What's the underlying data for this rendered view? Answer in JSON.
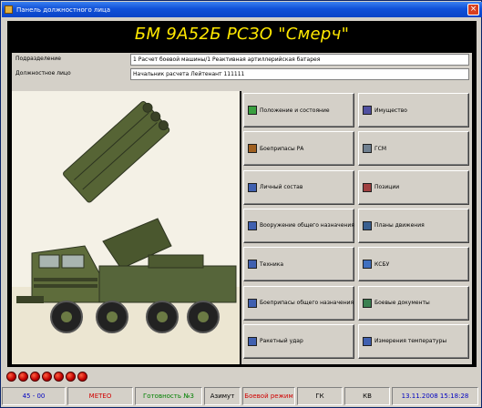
{
  "window": {
    "title": "Панель должностного лица",
    "close_glyph": "×"
  },
  "header": {
    "system_title": "БМ 9А52Б РСЗО \"Смерч\""
  },
  "info": {
    "unit_label": "Подразделение",
    "unit_value": "1 Расчет боевой машины/1 Реактивная артиллерийская батарея",
    "position_label": "Должностное лицо",
    "position_value": "Начальник расчета Лейтенант 111111"
  },
  "buttons": [
    {
      "label": "Положение и состояние",
      "icon": "position-state-icon"
    },
    {
      "label": "Имущество",
      "icon": "property-icon"
    },
    {
      "label": "Боеприпасы РА",
      "icon": "ammunition-icon"
    },
    {
      "label": "ГСМ",
      "icon": "fuel-icon"
    },
    {
      "label": "Личный состав",
      "icon": "personnel-icon"
    },
    {
      "label": "Позиции",
      "icon": "positions-icon"
    },
    {
      "label": "Вооружение общего назначения",
      "icon": "weapons-icon"
    },
    {
      "label": "Планы движения",
      "icon": "movement-plans-icon"
    },
    {
      "label": "Техника",
      "icon": "vehicle-icon"
    },
    {
      "label": "КСБУ",
      "icon": "ksbu-icon"
    },
    {
      "label": "Боеприпасы общего назначения",
      "icon": "general-ammo-icon"
    },
    {
      "label": "Боевые документы",
      "icon": "combat-docs-icon"
    },
    {
      "label": "Ракетный удар",
      "icon": "rocket-strike-icon"
    },
    {
      "label": "Измерения температуры",
      "icon": "temperature-icon"
    }
  ],
  "indicators": {
    "count": 7,
    "color": "#d00000"
  },
  "status": {
    "azimuth_value": "45 - 00",
    "meteo": "METEO",
    "readiness": "Готовность №3",
    "azimuth": "Азимут",
    "combat_mode": "Боевой режим",
    "gk": "ГК",
    "kv": "КВ",
    "datetime": "13.11.2008 15:18:28"
  },
  "colors": {
    "title_yellow": "#ffe800",
    "status_blue": "#0000c0",
    "status_red": "#d00000",
    "status_green": "#008000",
    "vehicle_green": "#5a6b3a"
  }
}
